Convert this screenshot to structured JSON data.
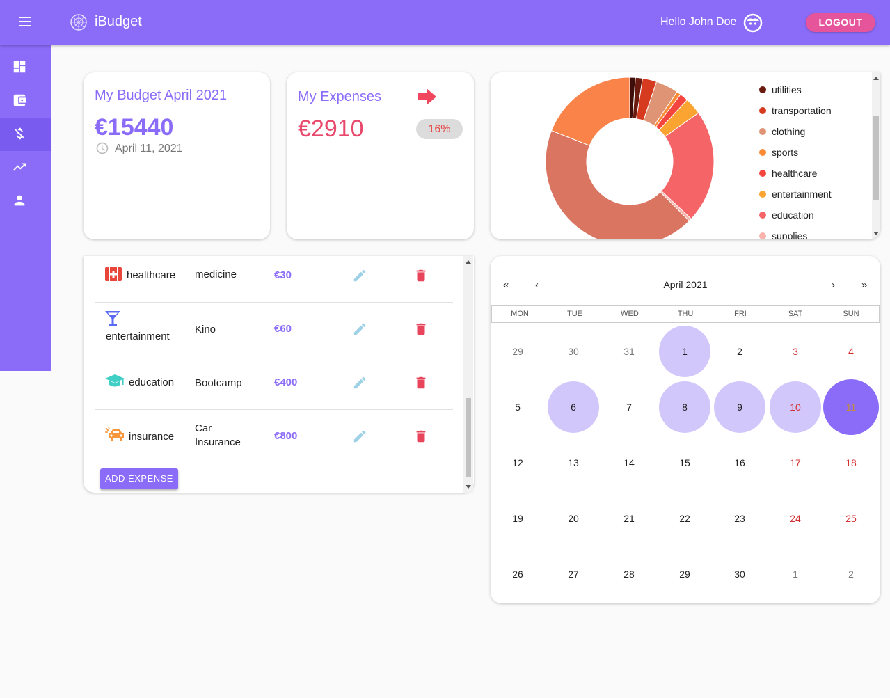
{
  "header": {
    "app_title": "iBudget",
    "greeting": "Hello John Doe",
    "logout_label": "LOGOUT",
    "accent_color": "#8b6cf8",
    "logout_color": "#e6559b"
  },
  "sidebar": {
    "items": [
      {
        "icon": "dashboard-icon"
      },
      {
        "icon": "wallet-icon"
      },
      {
        "icon": "money-off-icon",
        "active": true
      },
      {
        "icon": "trending-up-icon"
      },
      {
        "icon": "person-icon"
      }
    ]
  },
  "budget": {
    "title": "My Budget April 2021",
    "amount": "€15440",
    "date": "April 11, 2021"
  },
  "expenses_summary": {
    "title": "My Expenses",
    "amount": "€2910",
    "percent": "16%"
  },
  "chart_data": {
    "type": "pie",
    "donut": true,
    "legend_position": "right",
    "legend_visible": [
      "utilities",
      "transportation",
      "clothing",
      "sports",
      "healthcare",
      "entertainment",
      "education",
      "supplies"
    ],
    "series": [
      {
        "label": "",
        "value": 20,
        "color": "#3e0f0a"
      },
      {
        "label": "utilities",
        "value": 25,
        "color": "#6b1a10"
      },
      {
        "label": "transportation",
        "value": 50,
        "color": "#d63b20"
      },
      {
        "label": "clothing",
        "value": 80,
        "color": "#df9575"
      },
      {
        "label": "sports",
        "value": 15,
        "color": "#fb8a34"
      },
      {
        "label": "healthcare",
        "value": 30,
        "color": "#f4453e"
      },
      {
        "label": "entertainment",
        "value": 60,
        "color": "#fba432"
      },
      {
        "label": "education",
        "value": 400,
        "color": "#f56567"
      },
      {
        "label": "supplies",
        "value": 10,
        "color": "#f9b3ab"
      },
      {
        "label": "",
        "value": 800,
        "color": "#d97561"
      },
      {
        "label": "",
        "value": 350,
        "color": "#f98349"
      }
    ]
  },
  "expense_list": {
    "rows": [
      {
        "category": "healthcare",
        "description": "medicine",
        "amount": "€30",
        "icon": "hospital-icon"
      },
      {
        "category": "entertainment",
        "description": "Kino",
        "amount": "€60",
        "icon": "cocktail-icon"
      },
      {
        "category": "education",
        "description": "Bootcamp",
        "amount": "€400",
        "icon": "graduation-cap-icon"
      },
      {
        "category": "insurance",
        "description": "Car Insurance",
        "amount": "€800",
        "icon": "car-crash-icon"
      }
    ],
    "add_label": "ADD EXPENSE"
  },
  "calendar": {
    "title": "April 2021",
    "prev_year": "«",
    "prev_month": "‹",
    "next_month": "›",
    "next_year": "»",
    "weekdays": [
      "MON",
      "TUE",
      "WED",
      "THU",
      "FRI",
      "SAT",
      "SUN"
    ],
    "weeks": [
      [
        "29",
        "30",
        "31",
        "1",
        "2",
        "3",
        "4"
      ],
      [
        "5",
        "6",
        "7",
        "8",
        "9",
        "10",
        "11"
      ],
      [
        "12",
        "13",
        "14",
        "15",
        "16",
        "17",
        "18"
      ],
      [
        "19",
        "20",
        "21",
        "22",
        "23",
        "24",
        "25"
      ],
      [
        "26",
        "27",
        "28",
        "29",
        "30",
        "1",
        "2"
      ]
    ],
    "highlighted": [
      "1",
      "6",
      "8",
      "9",
      "10"
    ],
    "selected": "11"
  }
}
